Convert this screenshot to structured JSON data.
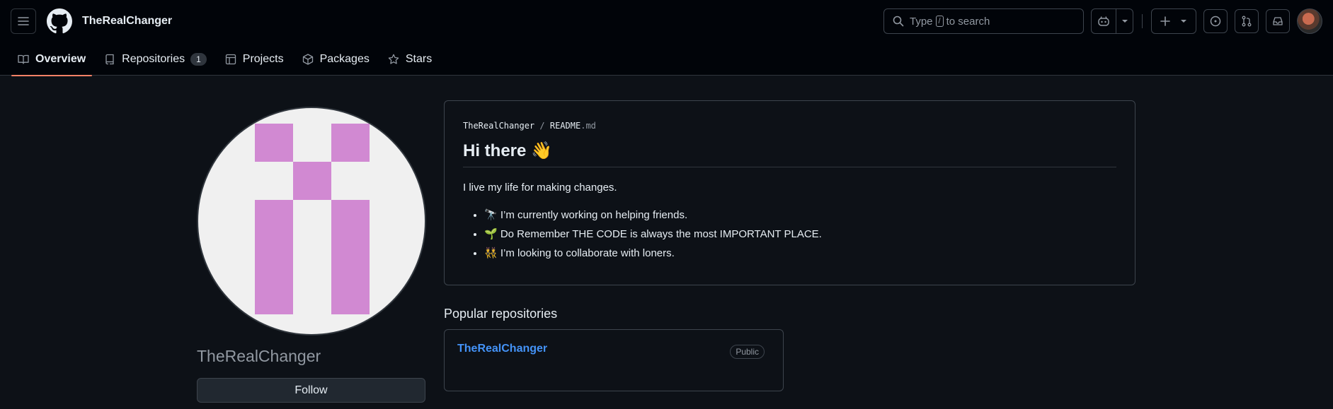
{
  "header": {
    "app_title": "TheRealChanger",
    "search": {
      "prefix": "Type",
      "key": "/",
      "suffix": "to search"
    }
  },
  "tabs": [
    {
      "label": "Overview",
      "icon": "book-icon"
    },
    {
      "label": "Repositories",
      "icon": "repo-icon",
      "count": "1"
    },
    {
      "label": "Projects",
      "icon": "table-icon"
    },
    {
      "label": "Packages",
      "icon": "package-icon"
    },
    {
      "label": "Stars",
      "icon": "star-icon"
    }
  ],
  "profile": {
    "username": "TheRealChanger",
    "follow_label": "Follow"
  },
  "readme": {
    "owner": "TheRealChanger",
    "file": "README",
    "ext": ".md",
    "heading": "Hi there 👋",
    "intro": "I live my life for making changes.",
    "items": [
      "🔭 I’m currently working on helping friends.",
      "🌱 Do Remember THE CODE is always the most IMPORTANT PLACE.",
      "👯 I’m looking to collaborate with loners."
    ]
  },
  "popular": {
    "title": "Popular repositories",
    "repos": [
      {
        "name": "TheRealChanger",
        "visibility": "Public"
      }
    ]
  },
  "colors": {
    "accent": "#f78166",
    "link": "#4493f8",
    "avatar_pixel": "#d189d2",
    "avatar_bg": "#f0f0f0"
  }
}
